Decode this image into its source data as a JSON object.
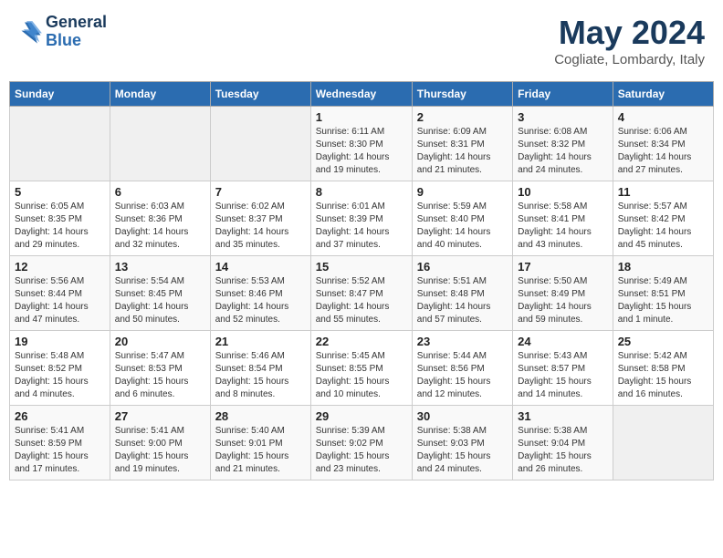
{
  "header": {
    "logo_line1": "General",
    "logo_line2": "Blue",
    "month": "May 2024",
    "location": "Cogliate, Lombardy, Italy"
  },
  "days_of_week": [
    "Sunday",
    "Monday",
    "Tuesday",
    "Wednesday",
    "Thursday",
    "Friday",
    "Saturday"
  ],
  "weeks": [
    [
      {
        "day": "",
        "info": ""
      },
      {
        "day": "",
        "info": ""
      },
      {
        "day": "",
        "info": ""
      },
      {
        "day": "1",
        "info": "Sunrise: 6:11 AM\nSunset: 8:30 PM\nDaylight: 14 hours\nand 19 minutes."
      },
      {
        "day": "2",
        "info": "Sunrise: 6:09 AM\nSunset: 8:31 PM\nDaylight: 14 hours\nand 21 minutes."
      },
      {
        "day": "3",
        "info": "Sunrise: 6:08 AM\nSunset: 8:32 PM\nDaylight: 14 hours\nand 24 minutes."
      },
      {
        "day": "4",
        "info": "Sunrise: 6:06 AM\nSunset: 8:34 PM\nDaylight: 14 hours\nand 27 minutes."
      }
    ],
    [
      {
        "day": "5",
        "info": "Sunrise: 6:05 AM\nSunset: 8:35 PM\nDaylight: 14 hours\nand 29 minutes."
      },
      {
        "day": "6",
        "info": "Sunrise: 6:03 AM\nSunset: 8:36 PM\nDaylight: 14 hours\nand 32 minutes."
      },
      {
        "day": "7",
        "info": "Sunrise: 6:02 AM\nSunset: 8:37 PM\nDaylight: 14 hours\nand 35 minutes."
      },
      {
        "day": "8",
        "info": "Sunrise: 6:01 AM\nSunset: 8:39 PM\nDaylight: 14 hours\nand 37 minutes."
      },
      {
        "day": "9",
        "info": "Sunrise: 5:59 AM\nSunset: 8:40 PM\nDaylight: 14 hours\nand 40 minutes."
      },
      {
        "day": "10",
        "info": "Sunrise: 5:58 AM\nSunset: 8:41 PM\nDaylight: 14 hours\nand 43 minutes."
      },
      {
        "day": "11",
        "info": "Sunrise: 5:57 AM\nSunset: 8:42 PM\nDaylight: 14 hours\nand 45 minutes."
      }
    ],
    [
      {
        "day": "12",
        "info": "Sunrise: 5:56 AM\nSunset: 8:44 PM\nDaylight: 14 hours\nand 47 minutes."
      },
      {
        "day": "13",
        "info": "Sunrise: 5:54 AM\nSunset: 8:45 PM\nDaylight: 14 hours\nand 50 minutes."
      },
      {
        "day": "14",
        "info": "Sunrise: 5:53 AM\nSunset: 8:46 PM\nDaylight: 14 hours\nand 52 minutes."
      },
      {
        "day": "15",
        "info": "Sunrise: 5:52 AM\nSunset: 8:47 PM\nDaylight: 14 hours\nand 55 minutes."
      },
      {
        "day": "16",
        "info": "Sunrise: 5:51 AM\nSunset: 8:48 PM\nDaylight: 14 hours\nand 57 minutes."
      },
      {
        "day": "17",
        "info": "Sunrise: 5:50 AM\nSunset: 8:49 PM\nDaylight: 14 hours\nand 59 minutes."
      },
      {
        "day": "18",
        "info": "Sunrise: 5:49 AM\nSunset: 8:51 PM\nDaylight: 15 hours\nand 1 minute."
      }
    ],
    [
      {
        "day": "19",
        "info": "Sunrise: 5:48 AM\nSunset: 8:52 PM\nDaylight: 15 hours\nand 4 minutes."
      },
      {
        "day": "20",
        "info": "Sunrise: 5:47 AM\nSunset: 8:53 PM\nDaylight: 15 hours\nand 6 minutes."
      },
      {
        "day": "21",
        "info": "Sunrise: 5:46 AM\nSunset: 8:54 PM\nDaylight: 15 hours\nand 8 minutes."
      },
      {
        "day": "22",
        "info": "Sunrise: 5:45 AM\nSunset: 8:55 PM\nDaylight: 15 hours\nand 10 minutes."
      },
      {
        "day": "23",
        "info": "Sunrise: 5:44 AM\nSunset: 8:56 PM\nDaylight: 15 hours\nand 12 minutes."
      },
      {
        "day": "24",
        "info": "Sunrise: 5:43 AM\nSunset: 8:57 PM\nDaylight: 15 hours\nand 14 minutes."
      },
      {
        "day": "25",
        "info": "Sunrise: 5:42 AM\nSunset: 8:58 PM\nDaylight: 15 hours\nand 16 minutes."
      }
    ],
    [
      {
        "day": "26",
        "info": "Sunrise: 5:41 AM\nSunset: 8:59 PM\nDaylight: 15 hours\nand 17 minutes."
      },
      {
        "day": "27",
        "info": "Sunrise: 5:41 AM\nSunset: 9:00 PM\nDaylight: 15 hours\nand 19 minutes."
      },
      {
        "day": "28",
        "info": "Sunrise: 5:40 AM\nSunset: 9:01 PM\nDaylight: 15 hours\nand 21 minutes."
      },
      {
        "day": "29",
        "info": "Sunrise: 5:39 AM\nSunset: 9:02 PM\nDaylight: 15 hours\nand 23 minutes."
      },
      {
        "day": "30",
        "info": "Sunrise: 5:38 AM\nSunset: 9:03 PM\nDaylight: 15 hours\nand 24 minutes."
      },
      {
        "day": "31",
        "info": "Sunrise: 5:38 AM\nSunset: 9:04 PM\nDaylight: 15 hours\nand 26 minutes."
      },
      {
        "day": "",
        "info": ""
      }
    ]
  ]
}
